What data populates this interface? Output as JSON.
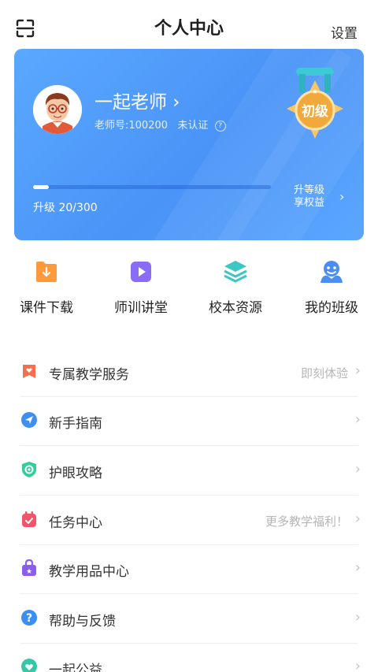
{
  "header": {
    "title": "个人中心",
    "settings_label": "设置",
    "scan_icon": "scan-icon"
  },
  "profile": {
    "name": "一起老师 ›",
    "teacher_id_text": "老师号:100200",
    "auth_status": "未认证",
    "help_icon": "question-circle-icon",
    "medal_text": "初级",
    "progress_text": "升级 20/300",
    "progress_fraction": 0.067,
    "upgrade_line1": "升等级",
    "upgrade_line2": "享权益",
    "upgrade_chevron": "›",
    "colors": {
      "card_bg": "#4a93f7",
      "medal": "#f2b24e"
    }
  },
  "quick_entries": [
    {
      "label": "课件下载",
      "icon": "download-folder-icon",
      "color": "#ff9a3c"
    },
    {
      "label": "师训讲堂",
      "icon": "video-play-icon",
      "color": "#8b6cf6"
    },
    {
      "label": "校本资源",
      "icon": "layers-icon",
      "color": "#3ec6c4"
    },
    {
      "label": "我的班级",
      "icon": "class-people-icon",
      "color": "#4a8df5"
    }
  ],
  "menu": [
    {
      "label": "专属教学服务",
      "note": "即刻体验",
      "icon": "heart-bookmark-icon",
      "color": "#f4704d"
    },
    {
      "label": "新手指南",
      "note": "",
      "icon": "navigation-arrow-icon",
      "color": "#3f8ff3"
    },
    {
      "label": "护眼攻略",
      "note": "",
      "icon": "eye-shield-icon",
      "color": "#2fcf9a"
    },
    {
      "label": "任务中心",
      "note": "更多教学福利！",
      "icon": "calendar-task-icon",
      "color": "#f2556a"
    },
    {
      "label": "教学用品中心",
      "note": "",
      "icon": "shopping-bag-icon",
      "color": "#8a5df0"
    },
    {
      "label": "帮助与反馈",
      "note": "",
      "icon": "help-circle-icon",
      "color": "#3a8ff4"
    },
    {
      "label": "一起公益",
      "note": "",
      "icon": "charity-heart-icon",
      "color": "#33c9a6"
    }
  ],
  "chevron": "›"
}
